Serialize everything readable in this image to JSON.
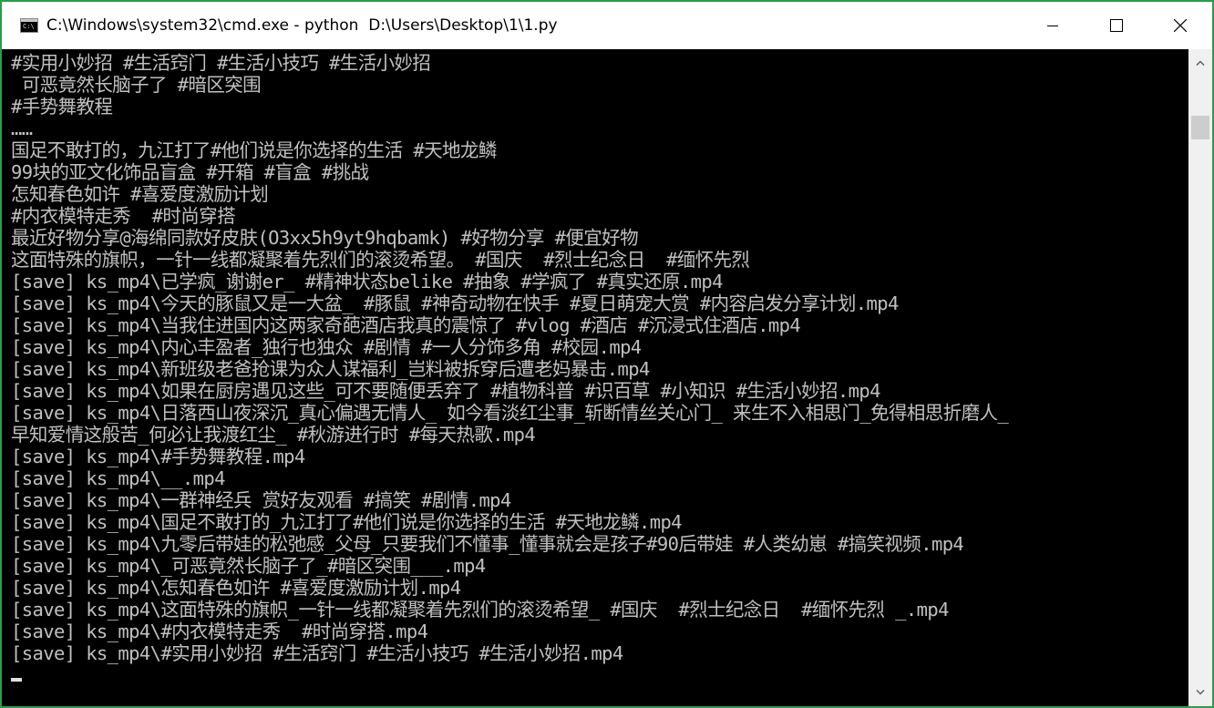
{
  "window": {
    "title": "C:\\Windows\\system32\\cmd.exe - python  D:\\Users\\Desktop\\1\\1.py",
    "icon_label": "C:\\",
    "controls": [
      "minimize-icon",
      "maximize-icon",
      "close-icon"
    ],
    "border_color": "#2e9b4a"
  },
  "console": {
    "text_color": "#c0c0c0",
    "background": "#000000",
    "lines": [
      "#实用小妙招 #生活窍门 #生活小技巧 #生活小妙招",
      " 可恶竟然长脑子了 #暗区突围",
      "#手势舞教程",
      "……",
      "国足不敢打的，九江打了#他们说是你选择的生活 #天地龙鳞",
      "99块的亚文化饰品盲盒 #开箱 #盲盒 #挑战",
      "怎知春色如许 #喜爱度激励计划",
      "#内衣模特走秀  #时尚穿搭",
      "最近好物分享@海绵同款好皮肤(O3xx5h9yt9hqbamk) #好物分享 #便宜好物",
      "这面特殊的旗帜，一针一线都凝聚着先烈们的滚烫希望。 #国庆  #烈士纪念日  #缅怀先烈",
      "[save] ks_mp4\\已学疯_谢谢er_ #精神状态belike #抽象 #学疯了 #真实还原.mp4",
      "[save] ks_mp4\\今天的豚鼠又是一大盆_ #豚鼠 #神奇动物在快手 #夏日萌宠大赏 #内容启发分享计划.mp4",
      "[save] ks_mp4\\当我住进国内这两家奇葩酒店我真的震惊了 #vlog #酒店 #沉浸式住酒店.mp4",
      "[save] ks_mp4\\内心丰盈者_独行也独众 #剧情 #一人分饰多角 #校园.mp4",
      "[save] ks_mp4\\新班级老爸抢课为众人谋福利_岂料被拆穿后遭老妈暴击.mp4",
      "[save] ks_mp4\\如果在厨房遇见这些_可不要随便丢弃了 #植物科普 #识百草 #小知识 #生活小妙招.mp4",
      "[save] ks_mp4\\日落西山夜深沉_真心偏遇无情人_ 如今看淡红尘事_斩断情丝关心门_ 来生不入相思门_免得相思折磨人_",
      "早知爱情这般苦_何必让我渡红尘_ #秋游进行时 #每天热歌.mp4",
      "[save] ks_mp4\\#手势舞教程.mp4",
      "[save] ks_mp4\\__.mp4",
      "[save] ks_mp4\\一群神经兵 赏好友观看 #搞笑 #剧情.mp4",
      "[save] ks_mp4\\国足不敢打的_九江打了#他们说是你选择的生活 #天地龙鳞.mp4",
      "[save] ks_mp4\\九零后带娃的松弛感_父母_只要我们不懂事_懂事就会是孩子#90后带娃 #人类幼崽 #搞笑视频.mp4",
      "[save] ks_mp4\\_可恶竟然长脑子了_#暗区突围___.mp4",
      "[save] ks_mp4\\怎知春色如许 #喜爱度激励计划.mp4",
      "[save] ks_mp4\\这面特殊的旗帜_一针一线都凝聚着先烈们的滚烫希望_ #国庆  #烈士纪念日  #缅怀先烈 _.mp4",
      "[save] ks_mp4\\#内衣模特走秀  #时尚穿搭.mp4",
      "[save] ks_mp4\\#实用小妙招 #生活窍门 #生活小技巧 #生活小妙招.mp4"
    ]
  },
  "scrollbar": {
    "up_icon": "scroll-up-arrow-icon",
    "down_icon": "scroll-down-arrow-icon"
  }
}
